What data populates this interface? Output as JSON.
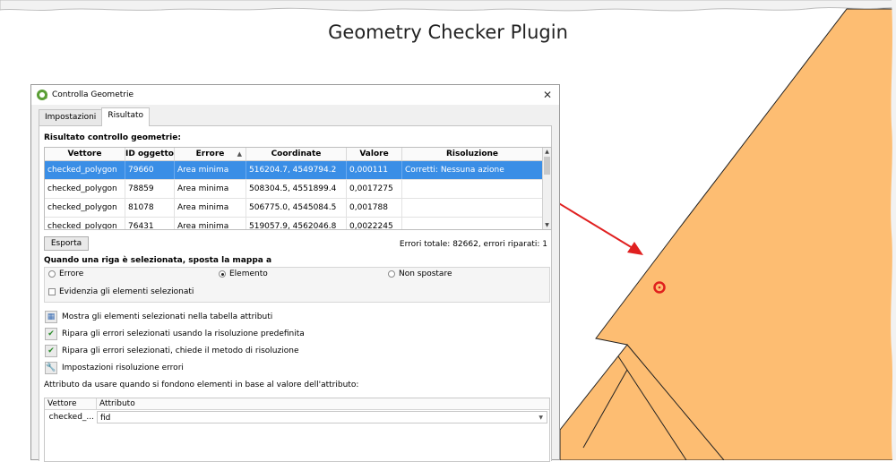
{
  "page_title": "Geometry Checker Plugin",
  "colors": {
    "map_fill": "#fdbd72",
    "arrow": "#e02020",
    "selection": "#3a8ee6",
    "marker": "#e0201d"
  },
  "dialog": {
    "title": "Controlla Geometrie",
    "close_glyph": "✕",
    "tabs": [
      "Impostazioni",
      "Risultato"
    ],
    "result_heading": "Risultato controllo geometrie:",
    "table": {
      "headers": [
        "Vettore",
        "ID oggetto",
        "Errore",
        "Coordinate",
        "Valore",
        "Risoluzione"
      ],
      "sort_glyph": "▲",
      "rows": [
        [
          "checked_polygon",
          "79660",
          "Area minima",
          "516204.7, 4549794.2",
          "0,000111",
          "Corretti: Nessuna azione"
        ],
        [
          "checked_polygon",
          "78859",
          "Area minima",
          "508304.5, 4551899.4",
          "0,0017275",
          ""
        ],
        [
          "checked_polygon",
          "81078",
          "Area minima",
          "506775.0, 4545084.5",
          "0,001788",
          ""
        ],
        [
          "checked_polygon",
          "76431",
          "Area minima",
          "519057.9, 4562046.8",
          "0,0022245",
          ""
        ]
      ]
    },
    "export_button": "Esporta",
    "totals": "Errori totale: 82662, errori riparati: 1",
    "move_heading": "Quando una riga è selezionata, sposta la mappa a",
    "radios": {
      "error": "Errore",
      "element": "Elemento",
      "none": "Non spostare"
    },
    "highlight_checkbox": "Evidenzia gli elementi selezionati",
    "actions": {
      "show_in_table": "Mostra gli elementi selezionati nella tabella attributi",
      "fix_default": "Ripara gli errori selezionati usando la risoluzione predefinita",
      "fix_ask": "Ripara gli errori selezionati, chiede il metodo di risoluzione",
      "settings": "Impostazioni risoluzione errori"
    },
    "attribute_heading": "Attributo da usare quando si fondono elementi in base al valore dell'attributo:",
    "attr_table": {
      "headers": [
        "Vettore",
        "Attributo"
      ],
      "row_layer": "checked_...",
      "row_attribute": "fid"
    }
  }
}
